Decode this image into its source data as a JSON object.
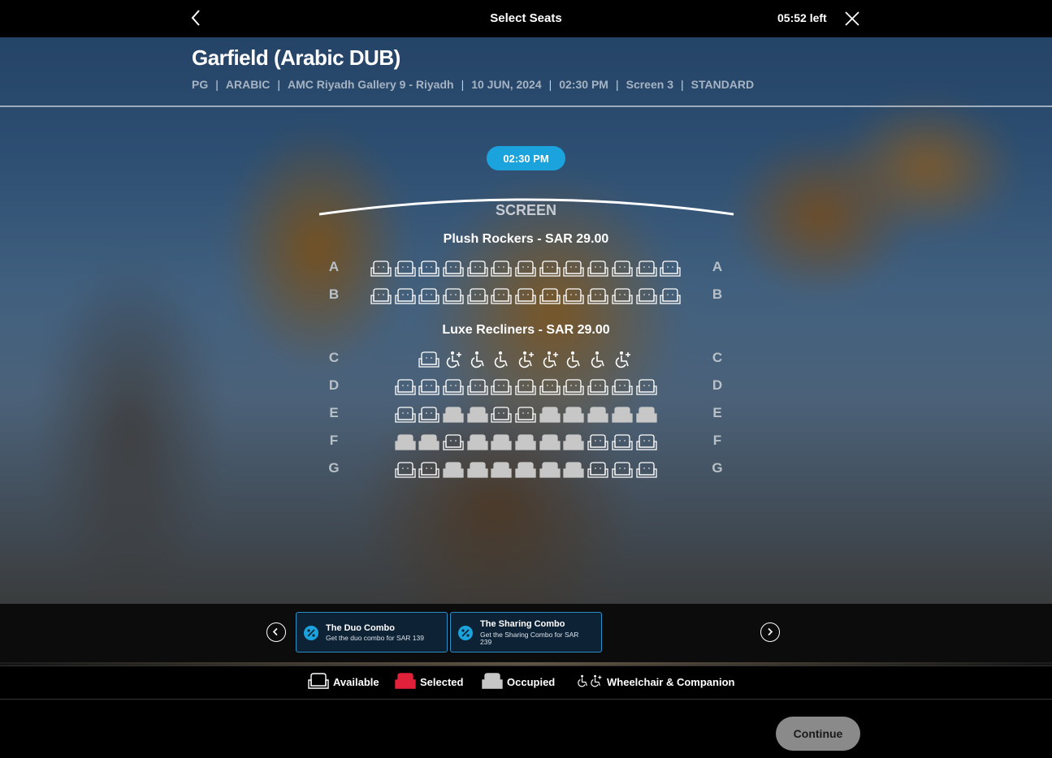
{
  "header": {
    "title": "Select Seats",
    "timer": "05:52 left"
  },
  "movie": {
    "title": "Garfield (Arabic DUB)",
    "meta": [
      "PG",
      "ARABIC",
      "AMC Riyadh Gallery 9 - Riyadh",
      "10 JUN, 2024",
      "02:30 PM",
      "Screen 3",
      "STANDARD"
    ]
  },
  "showtime": "02:30 PM",
  "screen_label": "SCREEN",
  "sections": [
    {
      "label": "Plush Rockers -  SAR  29.00",
      "rows": [
        {
          "row": "A",
          "seats": [
            "available",
            "available",
            "available",
            "available",
            "available",
            "available",
            "available",
            "available",
            "available",
            "available",
            "available",
            "available",
            "available"
          ]
        },
        {
          "row": "B",
          "seats": [
            "available",
            "available",
            "available",
            "available",
            "available",
            "available",
            "available",
            "available",
            "available",
            "available",
            "available",
            "available",
            "available"
          ]
        }
      ]
    },
    {
      "label": "Luxe Recliners -  SAR  29.00",
      "rows": [
        {
          "row": "C",
          "seats": [
            "available",
            "companion",
            "wheelchair",
            "wheelchair",
            "companion",
            "companion",
            "wheelchair",
            "wheelchair",
            "companion"
          ]
        },
        {
          "row": "D",
          "seats": [
            "available",
            "available",
            "available",
            "available",
            "available",
            "available",
            "available",
            "available",
            "available",
            "available",
            "available"
          ]
        },
        {
          "row": "E",
          "seats": [
            "available",
            "available",
            "occupied",
            "occupied",
            "available",
            "available",
            "occupied",
            "occupied",
            "occupied",
            "occupied",
            "occupied"
          ]
        },
        {
          "row": "F",
          "seats": [
            "occupied",
            "occupied",
            "available",
            "occupied",
            "occupied",
            "occupied",
            "occupied",
            "occupied",
            "available",
            "available",
            "available"
          ]
        },
        {
          "row": "G",
          "seats": [
            "available",
            "available",
            "occupied",
            "occupied",
            "occupied",
            "occupied",
            "occupied",
            "occupied",
            "available",
            "available",
            "available"
          ]
        }
      ]
    }
  ],
  "combos": [
    {
      "title": "The Duo Combo",
      "description": "Get the duo combo for SAR 139",
      "icon": "percent-icon"
    },
    {
      "title": "The Sharing Combo",
      "description": "Get the Sharing Combo for SAR 239",
      "icon": "percent-icon"
    }
  ],
  "legend": {
    "available": "Available",
    "selected": "Selected",
    "occupied": "Occupied",
    "wheelchair": "Wheelchair & Companion"
  },
  "continue_label": "Continue",
  "colors": {
    "accent": "#1aa3dd",
    "selected": "#e0213a",
    "occupied": "#c7c7c7",
    "available_outline": "#ffffff",
    "continue_bg": "#8a8a8a"
  }
}
